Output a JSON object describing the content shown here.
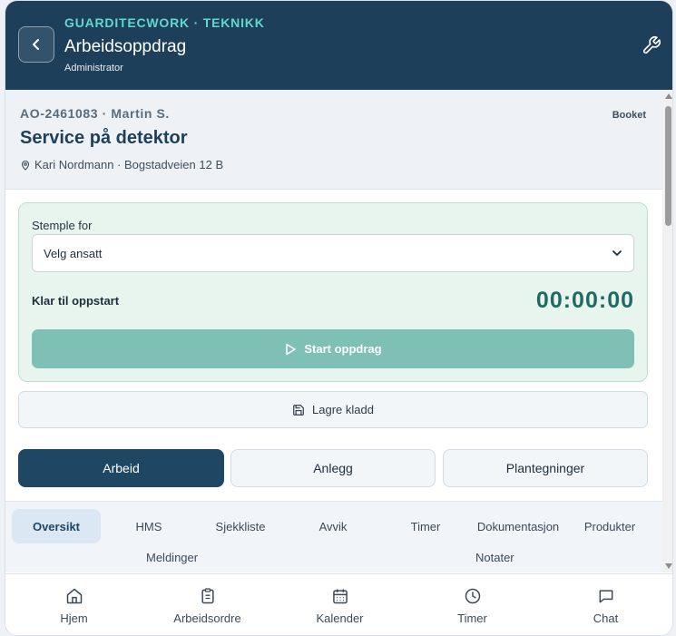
{
  "header": {
    "brand": "GUARDITECWORK · TEKNIKK",
    "title": "Arbeidsoppdrag",
    "role": "Administrator"
  },
  "job": {
    "id_line": "AO-2461083 · Martin S.",
    "status": "Booket",
    "title": "Service på detektor",
    "location": "Kari Nordmann · Bogstadveien 12 B"
  },
  "stamp": {
    "label": "Stemple for",
    "select_value": "Velg ansatt",
    "ready_text": "Klar til oppstart",
    "timer": "00:00:00",
    "start_label": "Start oppdrag"
  },
  "draft_label": "Lagre kladd",
  "segments": [
    "Arbeid",
    "Anlegg",
    "Plantegninger"
  ],
  "tabs": [
    "Oversikt",
    "HMS",
    "Sjekkliste",
    "Avvik",
    "Timer",
    "Dokumentasjon",
    "Produkter"
  ],
  "tabs_row2": [
    "Meldinger",
    "Notater"
  ],
  "nav": [
    "Hjem",
    "Arbeidsordre",
    "Kalender",
    "Timer",
    "Chat"
  ],
  "colors": {
    "header_bg": "#1e3f5a",
    "brand_accent": "#5fd8cf",
    "primary": "#1e4763",
    "start_button": "#7fc0b5",
    "timer": "#1e6b62"
  }
}
